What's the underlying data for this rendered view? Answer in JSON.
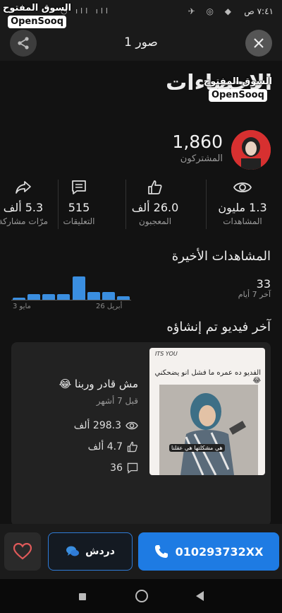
{
  "status_bar": {
    "time": "٧:٤١ ص"
  },
  "watermark": {
    "arabic": "السوق المفتوح",
    "english": "OpenSooq"
  },
  "header": {
    "title": "1 صور"
  },
  "stats_page": {
    "title": "الإحصاءات",
    "subscribers_count": "1,860",
    "subscribers_label": "المشتركون",
    "metrics": [
      {
        "icon": "eye-icon",
        "value": "1.3 مليون",
        "label": "المشاهدات"
      },
      {
        "icon": "thumbs-up-icon",
        "value": "26.0 ألف",
        "label": "المعجبون"
      },
      {
        "icon": "comment-icon",
        "value": "515",
        "label": "التعليقات"
      },
      {
        "icon": "share-arrow-icon",
        "value": "5.3 ألف",
        "label": "مرّات مشاركة"
      }
    ],
    "recent_views": {
      "title": "المشاهدات الأخيرة",
      "value": "33",
      "period": "آخر 7 أيام",
      "date_start": "26 أبريل",
      "date_end": "3 مايو"
    },
    "latest_video": {
      "section_title": "آخر فيديو تم إنشاؤه",
      "title": "مش قادر وربنا 😂",
      "time": "قبل 7 أشهر",
      "views": "298.3 ألف",
      "likes": "4.7 ألف",
      "comments": "36",
      "thumb_caption": "الفديو ده عمره ما فشل انو يضحكني 😂",
      "thumb_handle": "ITS YOU",
      "thumb_overlay": "هي مشكلتها هي عقلنا"
    }
  },
  "actions": {
    "chat_label": "دردش",
    "phone_label": "010293732XX"
  },
  "colors": {
    "accent": "#1e7be3",
    "bar": "#3a8ee0",
    "favorite": "#e05a5a"
  },
  "chart_data": {
    "type": "bar",
    "categories": [
      "26 أبريل",
      "",
      "",
      "",
      "",
      "",
      "",
      "3 مايو"
    ],
    "values": [
      2,
      4,
      4,
      12,
      3,
      3,
      3,
      1
    ],
    "title": "المشاهدات الأخيرة",
    "ylim": [
      0,
      14
    ]
  }
}
